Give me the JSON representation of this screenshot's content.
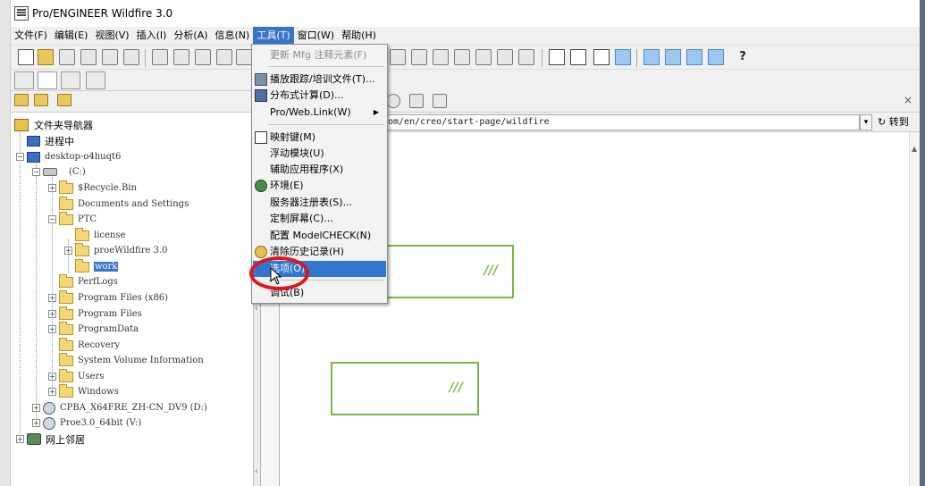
{
  "window": {
    "title": "Pro/ENGINEER Wildfire 3.0"
  },
  "menubar": {
    "items": [
      "文件(F)",
      "编辑(E)",
      "视图(V)",
      "插入(I)",
      "分析(A)",
      "信息(N)",
      "工具(T)",
      "窗口(W)",
      "帮助(H)"
    ],
    "active": "工具(T)"
  },
  "tools_menu": {
    "items": [
      {
        "label": "更新 Mfg 注释元素(F)",
        "disabled": true,
        "icon": null
      },
      {
        "label": "播放跟踪/培训文件(T)...",
        "disabled": false,
        "icon": "playback-icon"
      },
      {
        "label": "分布式计算(D)...",
        "disabled": false,
        "icon": "distributed-icon"
      },
      {
        "label": "Pro/Web.Link(W)",
        "disabled": false,
        "icon": null,
        "submenu": true
      },
      {
        "label": "映射键(M)",
        "disabled": false,
        "icon": "mapkey-icon"
      },
      {
        "label": "浮动模块(U)",
        "disabled": false,
        "icon": null
      },
      {
        "label": "辅助应用程序(X)",
        "disabled": false,
        "icon": null
      },
      {
        "label": "环境(E)",
        "disabled": false,
        "icon": "environment-icon"
      },
      {
        "label": "服务器注册表(S)...",
        "disabled": false,
        "icon": null
      },
      {
        "label": "定制屏幕(C)...",
        "disabled": false,
        "icon": null
      },
      {
        "label": "配置 ModelCHECK(N)",
        "disabled": false,
        "icon": null
      },
      {
        "label": "清除历史记录(H)",
        "disabled": false,
        "icon": "clear-history-icon"
      },
      {
        "label": "选项(O)",
        "disabled": false,
        "icon": null,
        "highlighted": true
      },
      {
        "label": "调试(B)",
        "disabled": false,
        "icon": null
      }
    ]
  },
  "navigator": {
    "root": "文件夹导航器",
    "tree": [
      {
        "label": "进程中",
        "type": "pc"
      },
      {
        "label": "desktop-o4huqt6",
        "type": "pc"
      },
      {
        "label": "(C:)",
        "type": "drive"
      },
      {
        "label": "$Recycle.Bin",
        "type": "folder"
      },
      {
        "label": "Documents and Settings",
        "type": "folder"
      },
      {
        "label": "PTC",
        "type": "folder"
      },
      {
        "label": "license",
        "type": "folder"
      },
      {
        "label": "proeWildfire 3.0",
        "type": "folder"
      },
      {
        "label": "work",
        "type": "folder",
        "selected": true
      },
      {
        "label": "PerfLogs",
        "type": "folder"
      },
      {
        "label": "Program Files (x86)",
        "type": "folder"
      },
      {
        "label": "Program Files",
        "type": "folder"
      },
      {
        "label": "ProgramData",
        "type": "folder"
      },
      {
        "label": "Recovery",
        "type": "folder"
      },
      {
        "label": "System Volume Information",
        "type": "folder"
      },
      {
        "label": "Users",
        "type": "folder"
      },
      {
        "label": "Windows",
        "type": "folder"
      },
      {
        "label": "CPBA_X64FRE_ZH-CN_DV9 (D:)",
        "type": "cd"
      },
      {
        "label": "Proe3.0_64bit (V:)",
        "type": "cd"
      },
      {
        "label": "网上邻居",
        "type": "network"
      }
    ]
  },
  "browser": {
    "address": "om/en/creo/start-page/wildfire",
    "goto_label": "转到",
    "card_mark": "///"
  },
  "colors": {
    "menu_highlight": "#3276d0",
    "card_border": "#76b843",
    "annotation_ring": "#e0141c"
  }
}
